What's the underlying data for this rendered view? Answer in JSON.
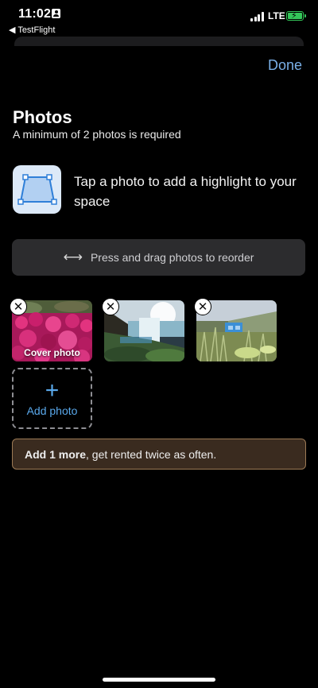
{
  "status_bar": {
    "time": "11:02",
    "back_app": "◀ TestFlight",
    "network": "LTE"
  },
  "header": {
    "done_label": "Done"
  },
  "photos_section": {
    "title": "Photos",
    "subtitle": "A minimum of 2 photos is required",
    "highlight_text": "Tap a photo to add a highlight to your space",
    "reorder_hint": "Press and drag photos to reorder",
    "reorder_arrow": "⟷",
    "cover_label": "Cover photo",
    "add_photo_plus": "+",
    "add_photo_label": "Add photo"
  },
  "banner": {
    "bold": "Add 1 more",
    "rest": ", get rented twice as often."
  },
  "icons": {
    "remove": "✕",
    "highlight": "highlight-quad-icon"
  },
  "colors": {
    "accent": "#5aa9ec",
    "done": "#7ab0e8",
    "banner_bg": "#3a2b1f",
    "banner_border": "#9c7a55"
  }
}
